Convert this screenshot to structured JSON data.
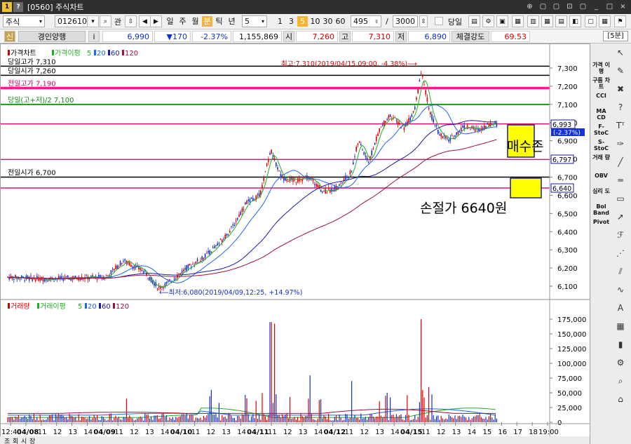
{
  "window": {
    "title": "[0560] 주식차트",
    "icon_a": "1",
    "icon_b": "?",
    "controls": [
      "⊕",
      "▢",
      "▢",
      "⊡",
      "▢",
      "_",
      "□",
      "×"
    ]
  },
  "toolbar": {
    "market": "주식",
    "code": "012610",
    "search_label": "관",
    "periods": [
      "일",
      "주",
      "월",
      "분",
      "틱",
      "년"
    ],
    "active_period": "분",
    "interval_value": "5",
    "interval_buttons": [
      "1",
      "3",
      "5",
      "10",
      "30",
      "60"
    ],
    "active_interval": "5",
    "count_value": "495",
    "total_value": "3000",
    "today_label": "당일"
  },
  "quote": {
    "tag": "신",
    "name": "경인양행",
    "info": "i",
    "price": "6,990",
    "change": "▼170",
    "rate": "-2.37%",
    "volume": "1,155,869",
    "open_label": "시",
    "open": "7,260",
    "high_label": "고",
    "high": "7,310",
    "low_label": "저",
    "low": "6,890",
    "strength_label": "체결강도",
    "strength": "69.53",
    "timeframe": "[5분]"
  },
  "legend_price": {
    "title": "가격차트",
    "ma_label": "가격이평",
    "mas": [
      "5",
      "20",
      "60",
      "120"
    ]
  },
  "legend_volume": {
    "title": "거래량",
    "ma_label": "거래이평",
    "mas": [
      "5",
      "20",
      "60",
      "120"
    ]
  },
  "colors": {
    "ma5": "#20b020",
    "ma20": "#1a66ff",
    "ma60": "#1a1aaa",
    "ma120": "#a01040",
    "up": "#e00000",
    "down": "#1030d0",
    "pink": "#ff1a8c",
    "green": "#1a9a1a"
  },
  "levels": [
    {
      "label": "당일고가 7,310",
      "value": 7310,
      "color": "#000000",
      "width": 1.5
    },
    {
      "label": "당일시가 7,260",
      "value": 7260,
      "color": "#000000",
      "width": 1.5
    },
    {
      "label": "전일고가 7,190",
      "value": 7190,
      "color": "#ff1a8c",
      "width": 3.5
    },
    {
      "label": "당일(고+저)/2 7,100",
      "value": 7100,
      "color": "#1a9a1a",
      "width": 2
    },
    {
      "label": "",
      "value": 6993,
      "color": "#e0107a",
      "width": 1.5
    },
    {
      "label": "",
      "value": 6797,
      "color": "#e0107a",
      "width": 1.5
    },
    {
      "label": "전일시가 6,700",
      "value": 6700,
      "color": "#000000",
      "width": 1.5
    },
    {
      "label": "",
      "value": 6640,
      "color": "#e0107a",
      "width": 1.5
    }
  ],
  "annotations": {
    "high": "최고:7,310(2019/04/15,09:00, -4.38%)⟶",
    "low": "⟵최저:6,080(2019/04/09,12:25, +14.97%)",
    "buy_zone": "매수존",
    "stop_loss": "손절가 6640원"
  },
  "price_tags": {
    "current": "6,993",
    "current_rate": "(-2.37%)",
    "tag_6797": "6,797",
    "tag_6640": "6,640"
  },
  "y_ticks_price": [
    "7,300",
    "7,200",
    "7,100",
    "7,000",
    "6,900",
    "6,800",
    "6,700",
    "6,600",
    "6,500",
    "6,400",
    "6,300",
    "6,200",
    "6,100"
  ],
  "y_ticks_volume": [
    "175,000",
    "150,000",
    "125,000",
    "100,000",
    "75,000",
    "50,000",
    "25,000",
    "0"
  ],
  "x_ticks": [
    "12:40",
    "04/08",
    "11",
    "12",
    "13",
    "14",
    "04/09",
    "11",
    "12",
    "13",
    "14",
    "04/10",
    "11",
    "12",
    "13",
    "14",
    "04/11",
    "11",
    "12",
    "13",
    "14",
    "04/12",
    "11",
    "12",
    "13",
    "14",
    "04/15",
    "11",
    "12",
    "13",
    "14",
    "15",
    "16",
    "17",
    "18",
    "19:00"
  ],
  "x_ticks_bold": [
    "04/08",
    "04/09",
    "04/10",
    "04/11",
    "04/12",
    "04/15"
  ],
  "sidebar": {
    "text_items": [
      "가격\n이평",
      "구름\n차트",
      "CCI",
      "MA\nCD",
      "F-\nStoC",
      "S-\nStoC",
      "거래\n량",
      "OBV",
      "심리\n도",
      "Bol\nBand",
      "Pivot"
    ],
    "icons": [
      "cursor-icon",
      "eraser-icon",
      "delete-icon",
      "help-icon",
      "text-tool-icon",
      "pen-icon",
      "line-icon",
      "hline-icon",
      "rect-icon",
      "arrow-icon",
      "fibo-icon",
      "gann-icon",
      "channel-icon",
      "wave-icon",
      "auto-icon",
      "grid-icon",
      "bar-icon",
      "settings-icon",
      "zoom-icon",
      "home-icon"
    ]
  },
  "bottombar": {
    "tabs": [
      "조",
      "회",
      "시",
      "장"
    ]
  }
}
